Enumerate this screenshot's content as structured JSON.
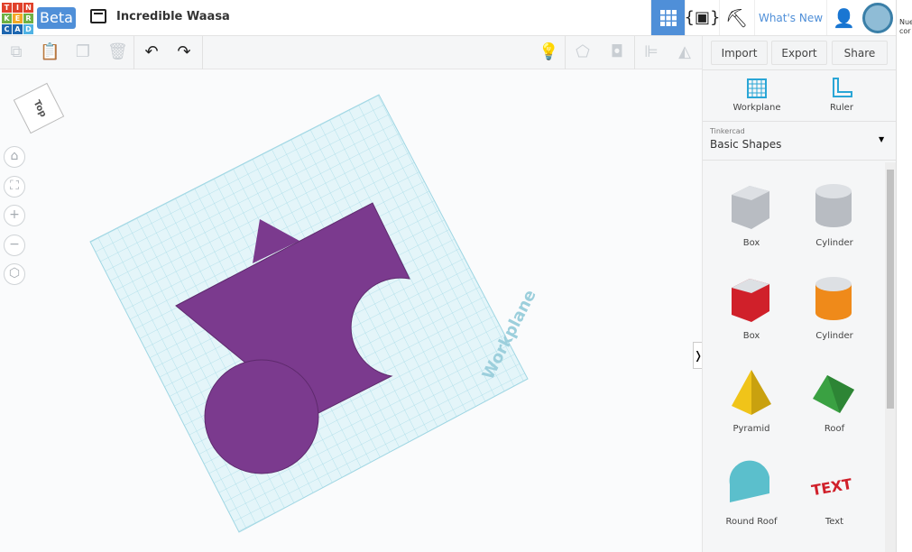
{
  "logo": {
    "letters": [
      "T",
      "I",
      "N",
      "K",
      "E",
      "R",
      "C",
      "A",
      "D"
    ],
    "colors": [
      "#e0412b",
      "#e0412b",
      "#e0412b",
      "#6eb043",
      "#f4a825",
      "#6eb043",
      "#1f67b0",
      "#1f67b0",
      "#4fb2e4"
    ]
  },
  "header": {
    "beta": "Beta",
    "title": "Incredible Waasa",
    "whats_new": "What's New"
  },
  "actions": {
    "import": "Import",
    "export": "Export",
    "share": "Share"
  },
  "canvas": {
    "view_cube": "Top",
    "workplane_label": "Workplane",
    "shape_color": "#7b3a8e",
    "grid_color": "#a8dce8"
  },
  "panel": {
    "workplane": "Workplane",
    "ruler": "Ruler",
    "library_source": "Tinkercad",
    "library": "Basic Shapes"
  },
  "shapes": [
    {
      "name": "Box",
      "color": "#b8bcc2"
    },
    {
      "name": "Cylinder",
      "color": "#b8bcc2"
    },
    {
      "name": "Box",
      "color": "#d0202a"
    },
    {
      "name": "Cylinder",
      "color": "#ef8a1a"
    },
    {
      "name": "Pyramid",
      "color": "#f0c419"
    },
    {
      "name": "Roof",
      "color": "#3aa142"
    },
    {
      "name": "Round Roof",
      "color": "#5bbfcc"
    },
    {
      "name": "Text",
      "color": "#d0202a"
    }
  ],
  "far_strip": {
    "line1": "Nue",
    "line2": "cor"
  }
}
